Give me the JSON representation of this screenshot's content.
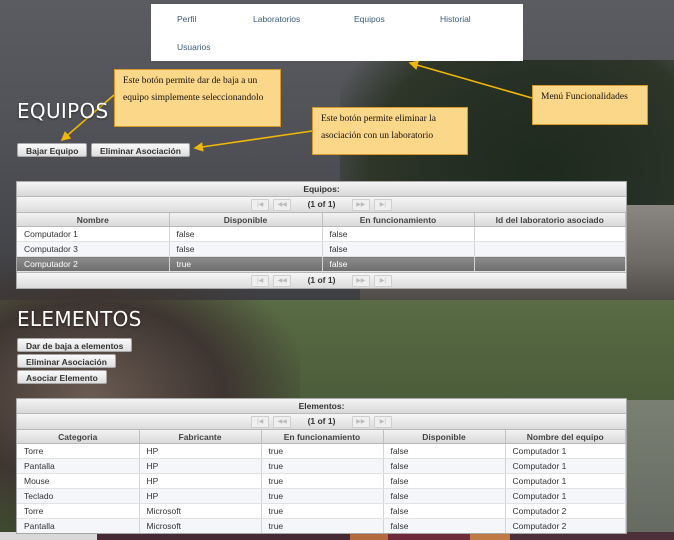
{
  "menu": {
    "items": [
      "Perfil",
      "Laboratorios",
      "Equipos",
      "Historial",
      "Usuarios"
    ]
  },
  "equipos": {
    "title": "EQUIPOS",
    "buttons": [
      "Bajar Equipo",
      "Eliminar Asociación"
    ],
    "table": {
      "caption": "Equipos:",
      "page": "(1 of 1)",
      "columns": [
        "Nombre",
        "Disponible",
        "En funcionamiento",
        "Id del laboratorio asociado"
      ],
      "rows": [
        [
          "Computador 1",
          "false",
          "false",
          ""
        ],
        [
          "Computador 3",
          "false",
          "false",
          ""
        ],
        [
          "Computador 2",
          "true",
          "false",
          ""
        ]
      ]
    }
  },
  "elementos": {
    "title": "ELEMENTOS",
    "buttons": [
      "Dar de baja a elementos",
      "Eliminar Asociación",
      "Asociar Elemento"
    ],
    "table": {
      "caption": "Elementos:",
      "page": "(1 of 1)",
      "columns": [
        "Categoria",
        "Fabricante",
        "En funcionamiento",
        "Disponible",
        "Nombre del equipo"
      ],
      "rows": [
        [
          "Torre",
          "HP",
          "true",
          "false",
          "Computador 1"
        ],
        [
          "Pantalla",
          "HP",
          "true",
          "false",
          "Computador 1"
        ],
        [
          "Mouse",
          "HP",
          "true",
          "false",
          "Computador 1"
        ],
        [
          "Teclado",
          "HP",
          "true",
          "false",
          "Computador 1"
        ],
        [
          "Torre",
          "Microsoft",
          "true",
          "false",
          "Computador 2"
        ],
        [
          "Pantalla",
          "Microsoft",
          "true",
          "false",
          "Computador 2"
        ]
      ]
    }
  },
  "callouts": {
    "bajar": "Este botón permite dar de baja a un equipo simplemente seleccionandolo",
    "eliminar": "Este botón permite eliminar la asociación con un laboratorio",
    "menu": "Menú Funcionalidades"
  },
  "colors": {
    "callout_fill": "#fbd78a",
    "callout_border": "#d59a2a",
    "arrow": "#f2b705",
    "selected_row": "#7a7a7a"
  }
}
